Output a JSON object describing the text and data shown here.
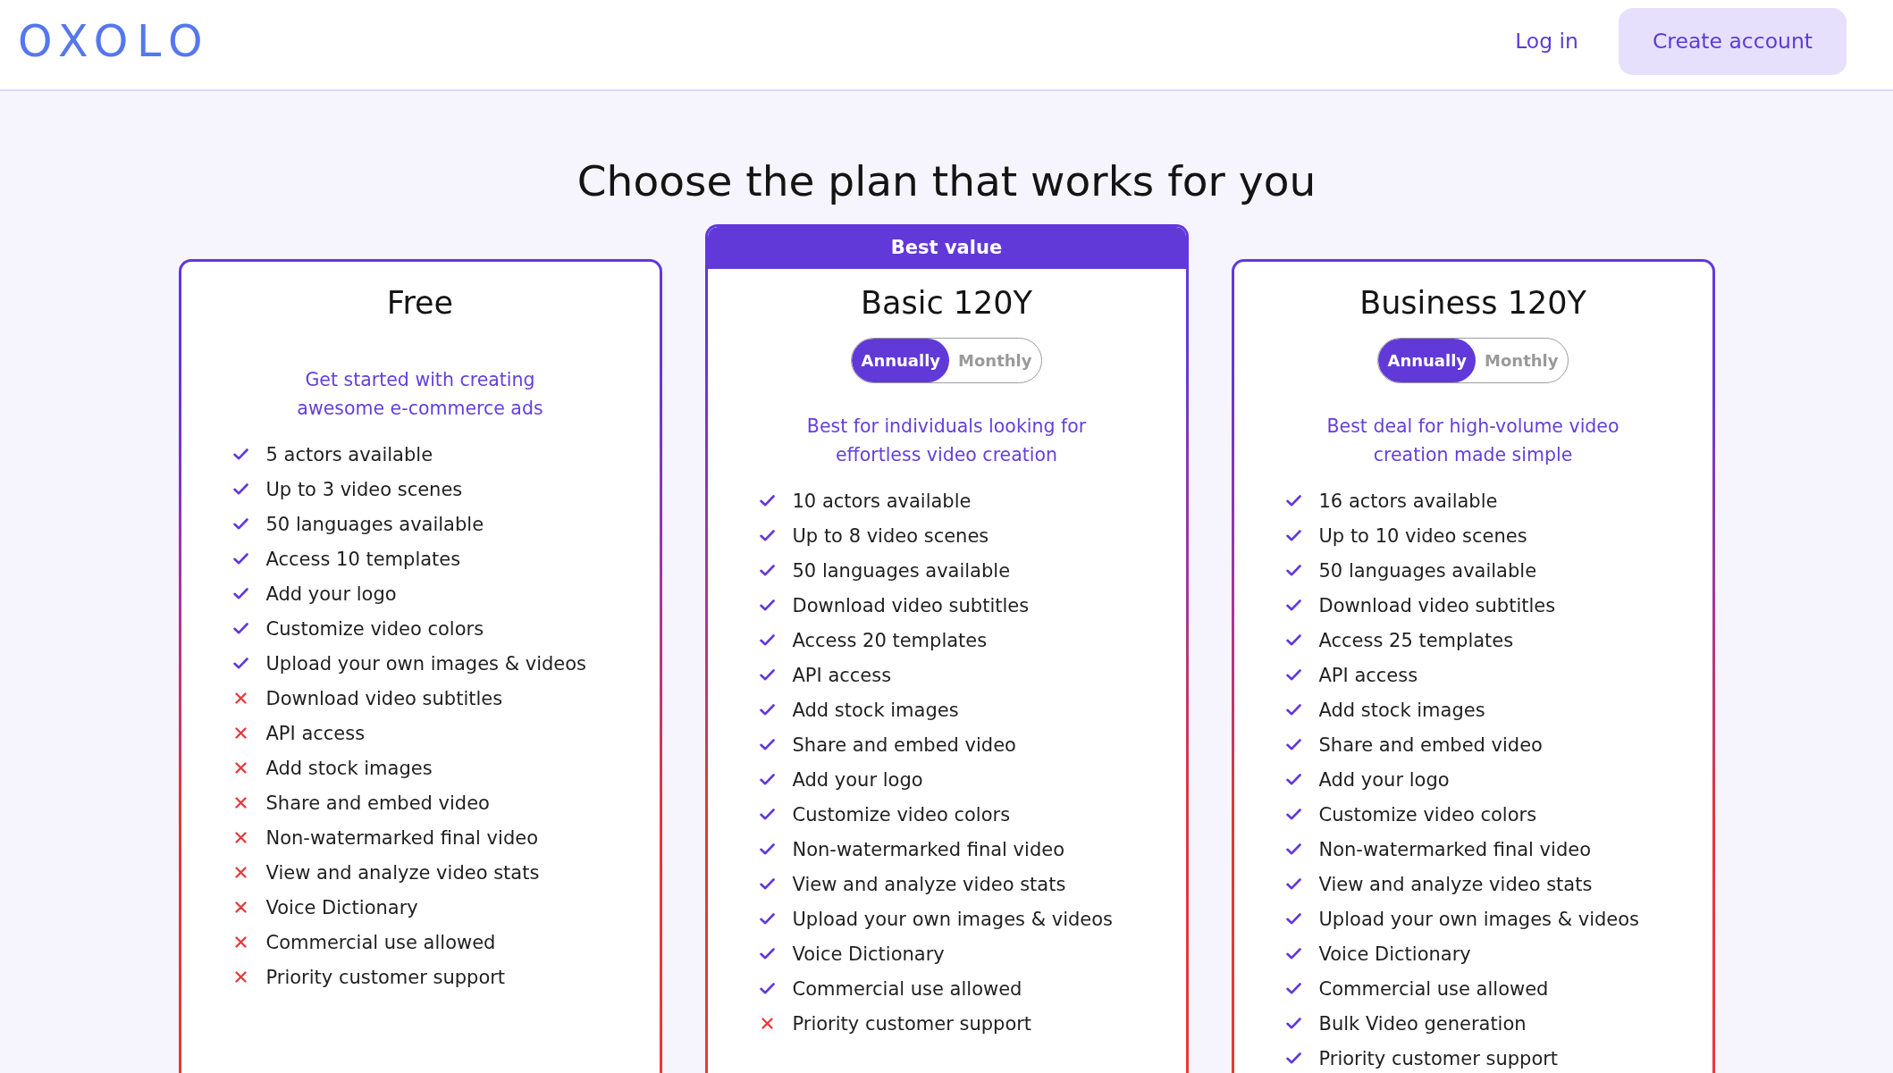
{
  "header": {
    "logo": "OXOLO",
    "login": "Log in",
    "create_account": "Create account"
  },
  "title": "Choose the plan that works for you",
  "plans": [
    {
      "name": "Free",
      "description": "Get started with creating awesome e-commerce ads",
      "features": [
        {
          "text": "5 actors available",
          "included": true
        },
        {
          "text": "Up to 3 video scenes",
          "included": true
        },
        {
          "text": "50 languages available",
          "included": true
        },
        {
          "text": "Access 10 templates",
          "included": true
        },
        {
          "text": "Add your logo",
          "included": true
        },
        {
          "text": "Customize video colors",
          "included": true
        },
        {
          "text": "Upload your own images & videos",
          "included": true
        },
        {
          "text": "Download video subtitles",
          "included": false
        },
        {
          "text": "API access",
          "included": false
        },
        {
          "text": "Add stock images",
          "included": false
        },
        {
          "text": "Share and embed video",
          "included": false
        },
        {
          "text": "Non-watermarked final video",
          "included": false
        },
        {
          "text": "View and analyze video stats",
          "included": false
        },
        {
          "text": "Voice Dictionary",
          "included": false
        },
        {
          "text": "Commercial use allowed",
          "included": false
        },
        {
          "text": "Priority customer support",
          "included": false
        }
      ]
    },
    {
      "name": "Basic 120Y",
      "badge": "Best value",
      "billing": [
        {
          "label": "Annually",
          "selected": true
        },
        {
          "label": "Monthly",
          "selected": false
        }
      ],
      "description": "Best for individuals looking for effortless video creation",
      "features": [
        {
          "text": "10 actors available",
          "included": true
        },
        {
          "text": "Up to 8 video scenes",
          "included": true
        },
        {
          "text": "50 languages available",
          "included": true
        },
        {
          "text": "Download video subtitles",
          "included": true
        },
        {
          "text": "Access 20 templates",
          "included": true
        },
        {
          "text": "API access",
          "included": true
        },
        {
          "text": "Add stock images",
          "included": true
        },
        {
          "text": "Share and embed video",
          "included": true
        },
        {
          "text": "Add your logo",
          "included": true
        },
        {
          "text": "Customize video colors",
          "included": true
        },
        {
          "text": "Non-watermarked final video",
          "included": true
        },
        {
          "text": "View and analyze video stats",
          "included": true
        },
        {
          "text": "Upload your own images & videos",
          "included": true
        },
        {
          "text": "Voice Dictionary",
          "included": true
        },
        {
          "text": "Commercial use allowed",
          "included": true
        },
        {
          "text": "Priority customer support",
          "included": false
        }
      ]
    },
    {
      "name": "Business 120Y",
      "billing": [
        {
          "label": "Annually",
          "selected": true
        },
        {
          "label": "Monthly",
          "selected": false
        }
      ],
      "description": "Best deal for high-volume video creation made simple",
      "features": [
        {
          "text": "16 actors available",
          "included": true
        },
        {
          "text": "Up to 10 video scenes",
          "included": true
        },
        {
          "text": "50 languages available",
          "included": true
        },
        {
          "text": "Download video subtitles",
          "included": true
        },
        {
          "text": "Access 25 templates",
          "included": true
        },
        {
          "text": "API access",
          "included": true
        },
        {
          "text": "Add stock images",
          "included": true
        },
        {
          "text": "Share and embed video",
          "included": true
        },
        {
          "text": "Add your logo",
          "included": true
        },
        {
          "text": "Customize video colors",
          "included": true
        },
        {
          "text": "Non-watermarked final video",
          "included": true
        },
        {
          "text": "View and analyze video stats",
          "included": true
        },
        {
          "text": "Upload your own images & videos",
          "included": true
        },
        {
          "text": "Voice Dictionary",
          "included": true
        },
        {
          "text": "Commercial use allowed",
          "included": true
        },
        {
          "text": "Bulk Video generation",
          "included": true
        },
        {
          "text": "Priority customer support",
          "included": true
        }
      ]
    }
  ]
}
